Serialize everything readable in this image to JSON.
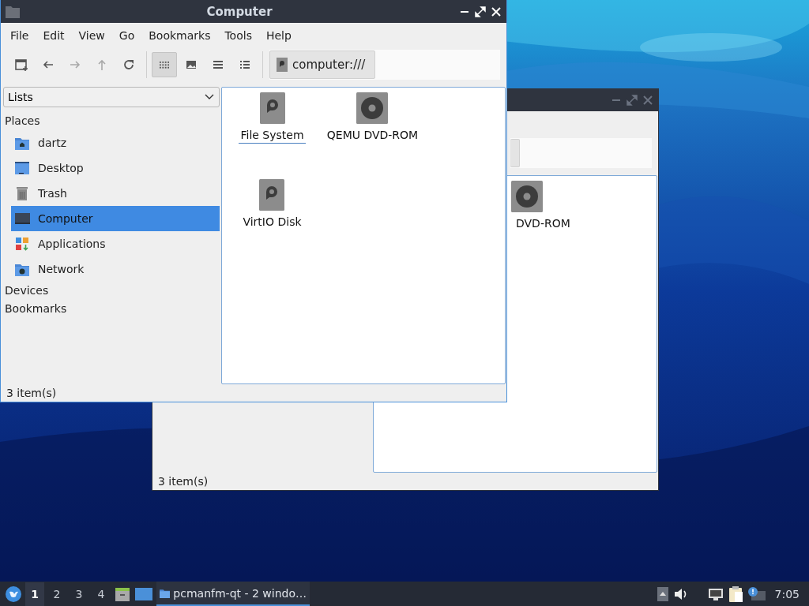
{
  "windows": [
    {
      "active": true,
      "title": "Computer",
      "menu": [
        "File",
        "Edit",
        "View",
        "Go",
        "Bookmarks",
        "Tools",
        "Help"
      ],
      "toolbar": [
        {
          "kind": "new-tab",
          "selected": false,
          "disabled": false
        },
        {
          "kind": "back",
          "selected": false,
          "disabled": false
        },
        {
          "kind": "forward",
          "selected": false,
          "disabled": true
        },
        {
          "kind": "up",
          "selected": false,
          "disabled": true
        },
        {
          "kind": "reload",
          "selected": false,
          "disabled": false
        },
        {
          "kind": "icon-view",
          "selected": true,
          "disabled": false
        },
        {
          "kind": "thumbnail-view",
          "selected": false,
          "disabled": false
        },
        {
          "kind": "compact-view",
          "selected": false,
          "disabled": false
        },
        {
          "kind": "detail-view",
          "selected": false,
          "disabled": false
        }
      ],
      "path": "computer:///",
      "side_pane_mode": "Lists",
      "sidebar": [
        {
          "label": "Places",
          "items": [
            {
              "label": "dartz",
              "kind": "home",
              "selected": false
            },
            {
              "label": "Desktop",
              "kind": "desktop",
              "selected": false
            },
            {
              "label": "Trash",
              "kind": "trash",
              "selected": false
            },
            {
              "label": "Computer",
              "kind": "computer",
              "selected": true
            },
            {
              "label": "Applications",
              "kind": "applications",
              "selected": false
            },
            {
              "label": "Network",
              "kind": "network",
              "selected": false
            }
          ]
        },
        {
          "label": "Devices"
        },
        {
          "label": "Bookmarks"
        }
      ],
      "items": [
        {
          "label": "File System",
          "kind": "disk",
          "focused": true
        },
        {
          "label": "QEMU DVD-ROM",
          "kind": "optical",
          "focused": false
        },
        {
          "label": "VirtIO Disk",
          "kind": "disk",
          "focused": false
        }
      ],
      "status": "3 item(s)"
    },
    {
      "active": false,
      "items": [
        {
          "label": "DVD-ROM",
          "kind": "optical",
          "focused": false
        }
      ],
      "status": "3 item(s)"
    }
  ],
  "taskbar": {
    "desktops": [
      {
        "label": "1",
        "selected": true
      },
      {
        "label": "2",
        "selected": false
      },
      {
        "label": "3",
        "selected": false
      },
      {
        "label": "4",
        "selected": false
      }
    ],
    "tasks": [
      {
        "label": "pcmanfm-qt - 2 windo…",
        "selected": true
      }
    ],
    "clock": "7:05"
  }
}
